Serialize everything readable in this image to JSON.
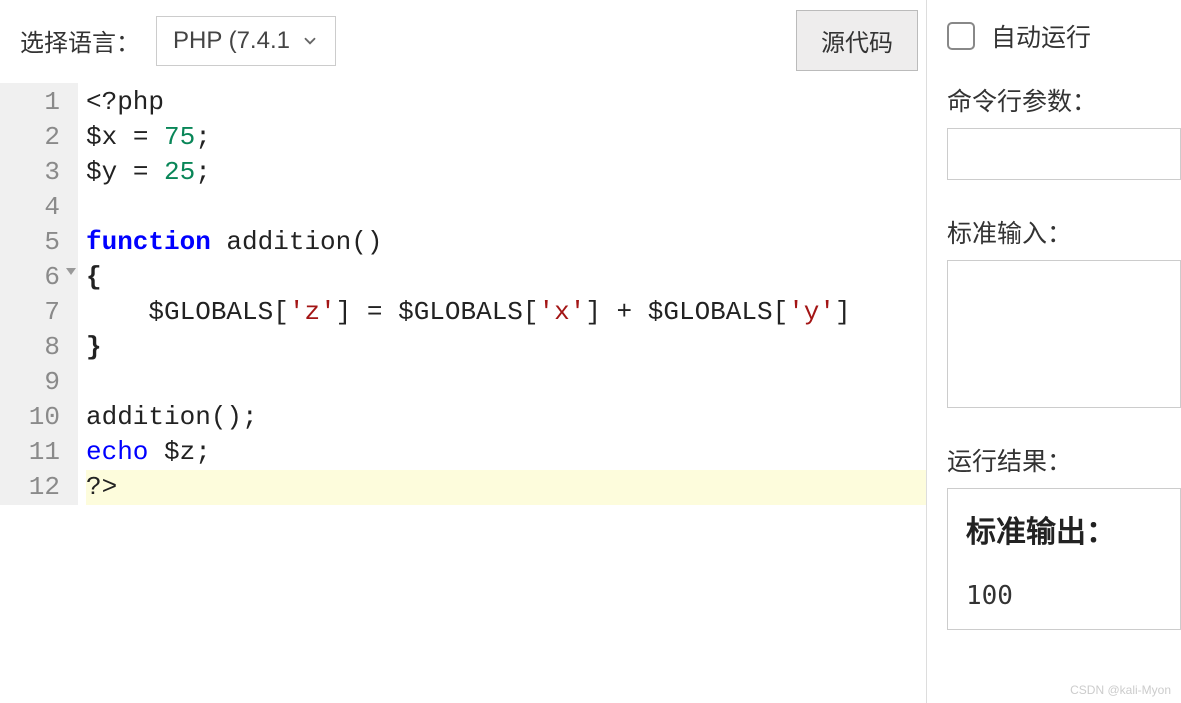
{
  "toolbar": {
    "lang_label": "选择语言：",
    "lang_selected": "PHP (7.4.1",
    "source_btn": "源代码"
  },
  "autorun": {
    "label": "自动运行",
    "checked": false
  },
  "fields": {
    "cmdline_label": "命令行参数：",
    "cmdline_value": "",
    "stdin_label": "标准输入：",
    "stdin_value": "",
    "result_label": "运行结果："
  },
  "output": {
    "title": "标准输出：",
    "value": "100"
  },
  "code": {
    "lines": [
      {
        "n": 1,
        "tokens": [
          [
            "open",
            "<?php"
          ]
        ]
      },
      {
        "n": 2,
        "tokens": [
          [
            "var",
            "$x"
          ],
          [
            "op",
            " = "
          ],
          [
            "num",
            "75"
          ],
          [
            "punc",
            ";"
          ]
        ]
      },
      {
        "n": 3,
        "tokens": [
          [
            "var",
            "$y"
          ],
          [
            "op",
            " = "
          ],
          [
            "num",
            "25"
          ],
          [
            "punc",
            ";"
          ]
        ]
      },
      {
        "n": 4,
        "tokens": []
      },
      {
        "n": 5,
        "tokens": [
          [
            "kw",
            "function"
          ],
          [
            "fn",
            " addition"
          ],
          [
            "punc",
            "()"
          ]
        ]
      },
      {
        "n": 6,
        "fold": true,
        "tokens": [
          [
            "brace",
            "{"
          ]
        ]
      },
      {
        "n": 7,
        "tokens": [
          [
            "indent",
            "    "
          ],
          [
            "globals",
            "$GLOBALS"
          ],
          [
            "punc",
            "["
          ],
          [
            "str",
            "'z'"
          ],
          [
            "punc",
            "]"
          ],
          [
            "op",
            " = "
          ],
          [
            "globals",
            "$GLOBALS"
          ],
          [
            "punc",
            "["
          ],
          [
            "str",
            "'x'"
          ],
          [
            "punc",
            "]"
          ],
          [
            "op",
            " + "
          ],
          [
            "globals",
            "$GLOBALS"
          ],
          [
            "punc",
            "["
          ],
          [
            "str",
            "'y'"
          ],
          [
            "punc",
            "]"
          ]
        ]
      },
      {
        "n": 8,
        "tokens": [
          [
            "brace",
            "}"
          ]
        ]
      },
      {
        "n": 9,
        "tokens": []
      },
      {
        "n": 10,
        "tokens": [
          [
            "fn",
            "addition"
          ],
          [
            "punc",
            "();"
          ]
        ]
      },
      {
        "n": 11,
        "tokens": [
          [
            "kw2",
            "echo"
          ],
          [
            "var",
            " $z"
          ],
          [
            "punc",
            ";"
          ]
        ]
      },
      {
        "n": 12,
        "highlighted": true,
        "tokens": [
          [
            "close",
            "?>"
          ]
        ]
      }
    ]
  },
  "watermark": "CSDN @kali-Myon",
  "colors": {
    "gutter_bg": "#f0f0f0",
    "highlight_bg": "#fdfcdc",
    "string": "#a31515",
    "keyword": "#0000ff",
    "number": "#098658"
  }
}
